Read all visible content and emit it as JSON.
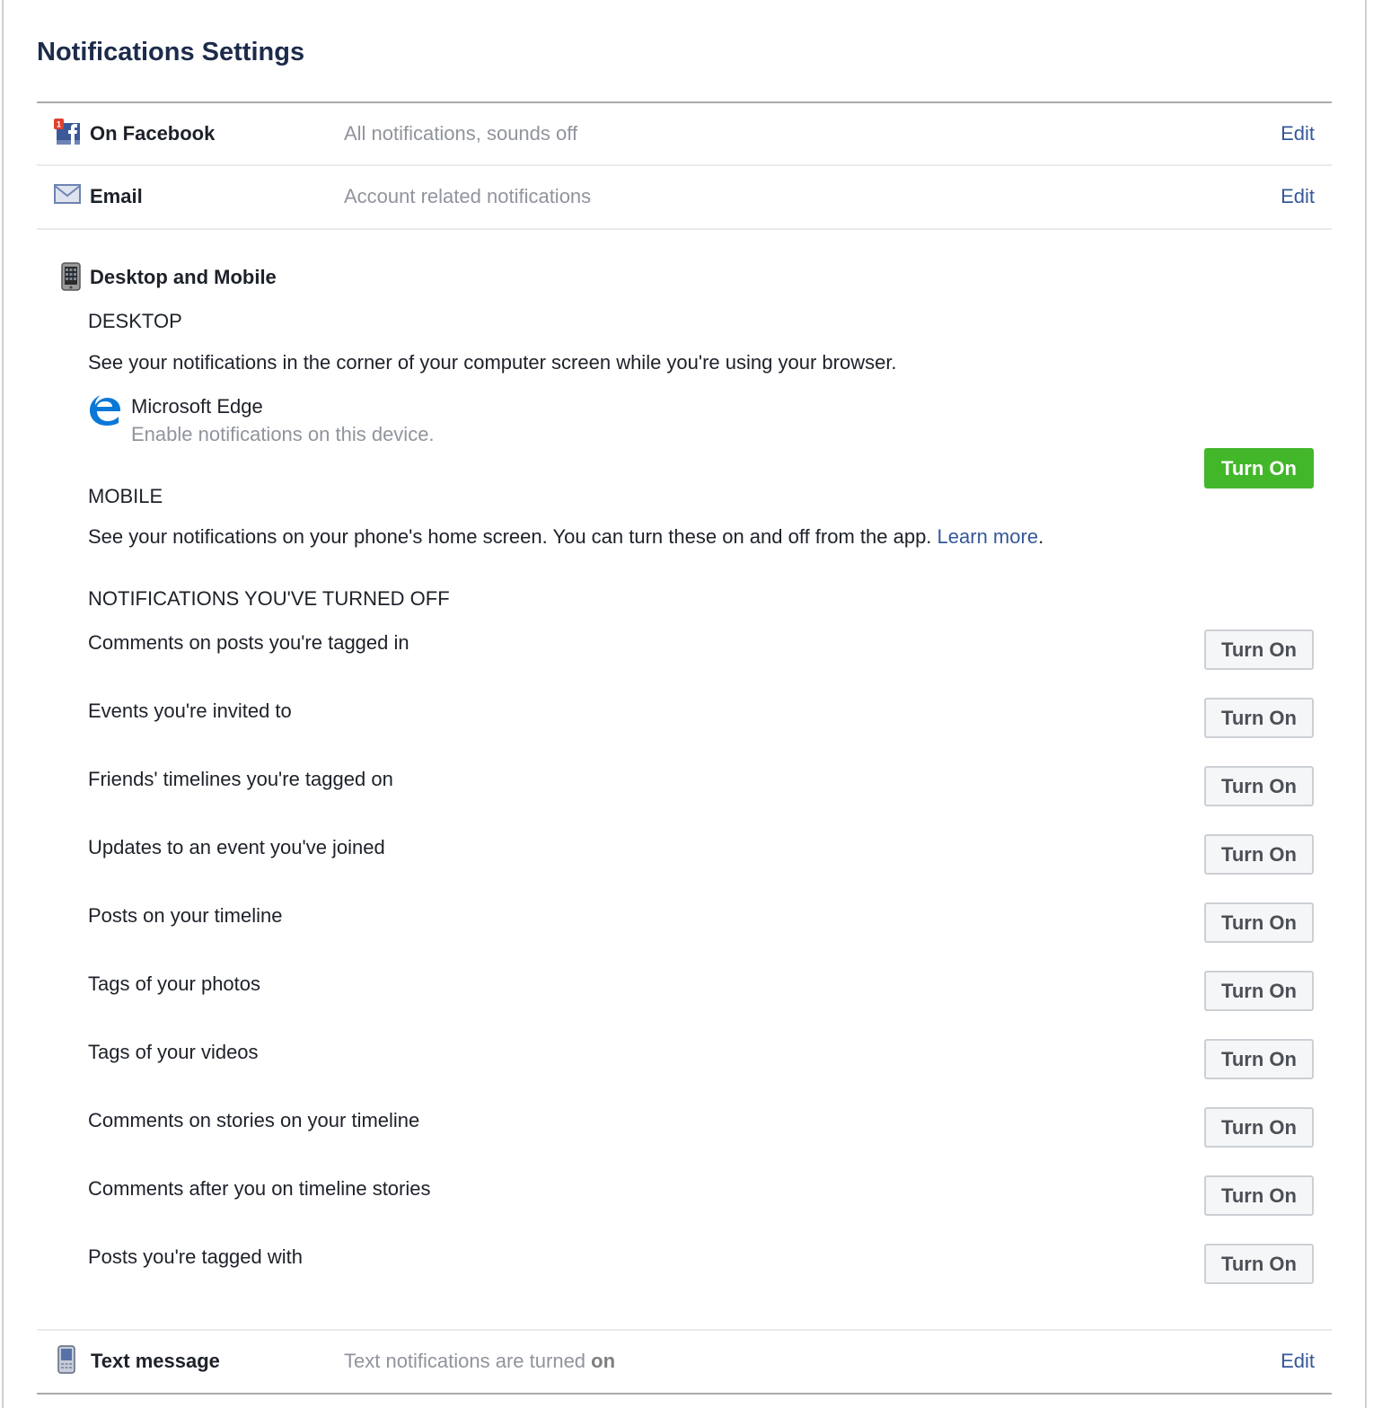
{
  "page": {
    "title": "Notifications Settings"
  },
  "rows": {
    "on_facebook": {
      "icon": "facebook-notification-icon",
      "label": "On Facebook",
      "description": "All notifications, sounds off",
      "action": "Edit",
      "badge": "1"
    },
    "email": {
      "icon": "envelope-icon",
      "label": "Email",
      "description": "Account related notifications",
      "action": "Edit"
    },
    "text_message": {
      "icon": "mobile-phone-icon",
      "label": "Text message",
      "description_prefix": "Text notifications are turned ",
      "description_state": "on",
      "action": "Edit"
    }
  },
  "desktop_mobile": {
    "label": "Desktop and Mobile",
    "desktop": {
      "heading": "DESKTOP",
      "description": "See your notifications in the corner of your computer screen while you're using your browser.",
      "browser_name": "Microsoft Edge",
      "browser_hint": "Enable notifications on this device.",
      "action": "Turn On"
    },
    "mobile": {
      "heading": "MOBILE",
      "description": "See your notifications on your phone's home screen. You can turn these on and off from the app.",
      "link": "Learn more",
      "suffix": "."
    },
    "turned_off": {
      "heading": "NOTIFICATIONS YOU'VE TURNED OFF",
      "action": "Turn On",
      "items": [
        "Comments on posts you're tagged in",
        "Events you're invited to",
        "Friends' timelines you're tagged on",
        "Updates to an event you've joined",
        "Posts on your timeline",
        "Tags of your photos",
        "Tags of your videos",
        "Comments on stories on your timeline",
        "Comments after you on timeline stories",
        "Posts you're tagged with"
      ]
    }
  },
  "colors": {
    "link": "#365899",
    "primary_button": "#42b72a",
    "title": "#1c2b4a",
    "muted": "#90949c"
  }
}
